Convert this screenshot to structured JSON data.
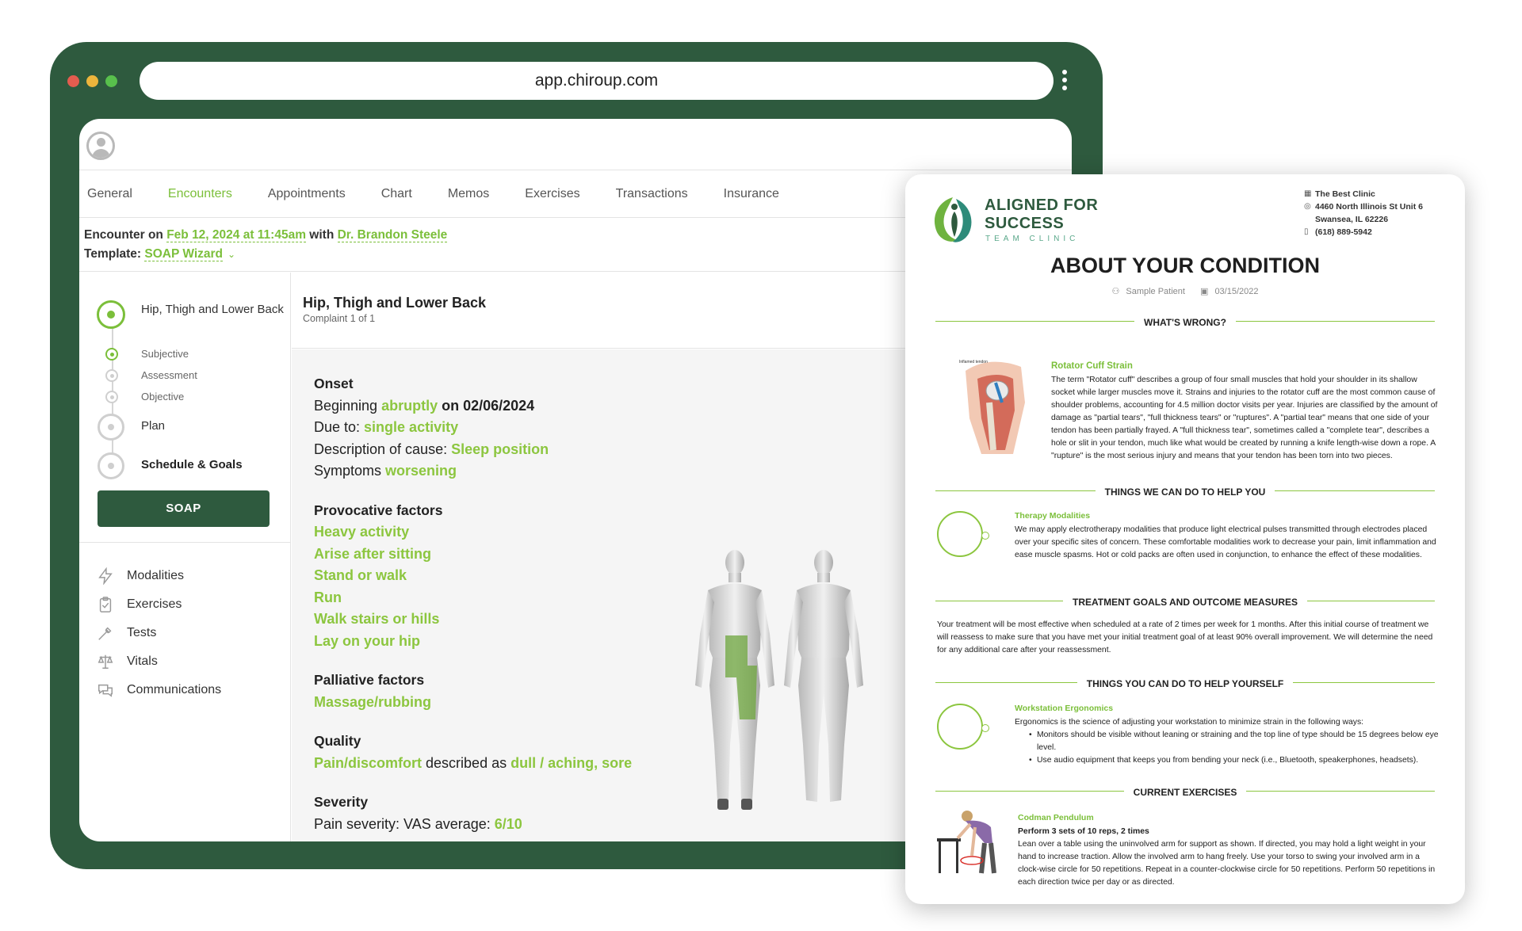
{
  "browser": {
    "url": "app.chiroup.com"
  },
  "tabs": [
    "General",
    "Encounters",
    "Appointments",
    "Chart",
    "Memos",
    "Exercises",
    "Transactions",
    "Insurance"
  ],
  "encounter": {
    "prefix": "Encounter on ",
    "date": "Feb 12, 2024 at 11:45am",
    "with": " with ",
    "provider": "Dr. Brandon Steele",
    "template_label": "Template: ",
    "template_value": "SOAP Wizard"
  },
  "sidebar": {
    "complaint": "Hip, Thigh and Lower Back",
    "sub_steps": [
      "Subjective",
      "Assessment",
      "Objective"
    ],
    "plan": "Plan",
    "schedule": "Schedule & Goals",
    "soap_button": "SOAP",
    "tools": [
      "Modalities",
      "Exercises",
      "Tests",
      "Vitals",
      "Communications"
    ]
  },
  "complaint_header": {
    "title": "Hip, Thigh and Lower Back",
    "subtitle": "Complaint 1 of 1"
  },
  "details": {
    "onset": {
      "title": "Onset",
      "beginning_label": "Beginning ",
      "beginning_value": "abruptly",
      "beginning_date": " on 02/06/2024",
      "due_label": "Due to: ",
      "due_value": "single activity",
      "cause_label": "Description of cause: ",
      "cause_value": "Sleep position",
      "symptoms_label": "Symptoms ",
      "symptoms_value": "worsening"
    },
    "provocative": {
      "title": "Provocative factors",
      "items": [
        "Heavy activity",
        "Arise after sitting",
        "Stand or walk",
        "Run",
        "Walk stairs or hills",
        "Lay on your hip"
      ]
    },
    "palliative": {
      "title": "Palliative factors",
      "items": [
        "Massage/rubbing"
      ]
    },
    "quality": {
      "title": "Quality",
      "value1": "Pain/discomfort",
      "mid": " described as ",
      "value2": "dull / aching, sore"
    },
    "severity": {
      "title": "Severity",
      "label": "Pain severity: VAS average: ",
      "value": "6/10"
    }
  },
  "handout": {
    "logo_title": "ALIGNED FOR SUCCESS",
    "logo_sub": "TEAM CLINIC",
    "clinic_name": "The Best Clinic",
    "clinic_address1": "4460 North Illinois St Unit 6",
    "clinic_address2": "Swansea, IL 62226",
    "clinic_phone": "(618) 889-5942",
    "title": "ABOUT YOUR CONDITION",
    "patient": "Sample Patient",
    "date": "03/15/2022",
    "sections": {
      "whats_wrong": "WHAT'S WRONG?",
      "we_can_do": "THINGS WE CAN DO TO HELP YOU",
      "goals": "TREATMENT GOALS AND OUTCOME MEASURES",
      "you_can_do": "THINGS YOU CAN DO TO HELP YOURSELF",
      "exercises": "CURRENT EXERCISES"
    },
    "condition": {
      "title": "Rotator Cuff Strain",
      "image_label": "Inflamed tendon",
      "text": "The term \"Rotator cuff\" describes a group of four small muscles that hold your shoulder in its shallow socket while larger muscles move it. Strains and injuries to the rotator cuff are the most common cause of shoulder problems, accounting for 4.5 million doctor visits per year. Injuries are classified by the amount of damage as \"partial tears\", \"full thickness tears\" or \"ruptures\". A \"partial tear\" means that one side of your tendon has been partially frayed. A \"full thickness tear\", sometimes called a \"complete tear\", describes a hole or slit in your tendon, much like what would be created by running a knife length-wise down a rope. A \"rupture\" is the most serious injury and means that your tendon has been torn into two pieces."
    },
    "therapy": {
      "title": "Therapy Modalities",
      "text": "We may apply electrotherapy modalities that produce light electrical pulses transmitted through electrodes placed over your specific sites of concern. These comfortable modalities work to decrease your pain, limit inflammation and ease muscle spasms. Hot or cold packs are often used in conjunction, to enhance the effect of these modalities."
    },
    "goals_text": "Your treatment will be most effective when scheduled at a rate of 2 times per week for 1 months. After this initial course of treatment we will reassess to make sure that you have met your initial treatment goal of at least 90% overall improvement. We will determine the need for any additional care after your reassessment.",
    "ergonomics": {
      "title": "Workstation Ergonomics",
      "text": "Ergonomics is the science of adjusting your workstation to minimize strain in the following ways:",
      "bullets": [
        "Monitors should be visible without leaning or straining and the top line of type should be 15 degrees below eye level.",
        "Use audio equipment that keeps you from bending your neck (i.e., Bluetooth, speakerphones, headsets)."
      ]
    },
    "exercise": {
      "title": "Codman Pendulum",
      "dosage": "Perform 3 sets of 10 reps, 2 times",
      "text": "Lean over a table using the uninvolved arm for support as shown. If directed, you may hold a light weight in your hand to increase traction. Allow the involved arm to hang freely. Use your torso to swing your involved arm in a clock-wise circle for 50 repetitions. Repeat in a counter-clockwise circle for 50 repetitions. Perform 50 repetitions in each direction twice per day or as directed."
    }
  }
}
